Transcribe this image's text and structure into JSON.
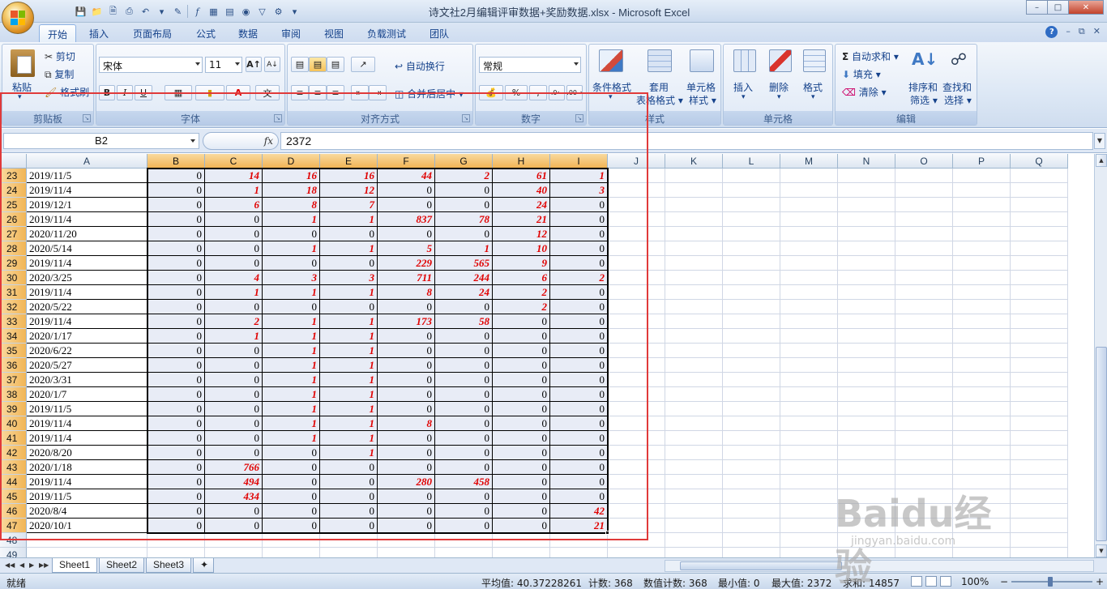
{
  "window": {
    "title": "诗文社2月编辑评审数据+奖励数据.xlsx - Microsoft Excel"
  },
  "ribbon_tabs": [
    "开始",
    "插入",
    "页面布局",
    "公式",
    "数据",
    "审阅",
    "视图",
    "负载测试",
    "团队"
  ],
  "clipboard": {
    "paste": "粘贴",
    "cut": "剪切",
    "copy": "复制",
    "format_painter": "格式刷",
    "label": "剪贴板"
  },
  "font": {
    "name": "宋体",
    "size": "11",
    "bold": "B",
    "italic": "I",
    "underline": "U",
    "label": "字体"
  },
  "alignment": {
    "wrap_text": "自动换行",
    "merge_center": "合并后居中",
    "label": "对齐方式"
  },
  "number": {
    "format": "常规",
    "percent": "%",
    "label": "数字"
  },
  "styles": {
    "conditional": "条件格式",
    "table_format_1": "套用",
    "table_format_2": "表格格式",
    "cell_styles_1": "单元格",
    "cell_styles_2": "样式",
    "label": "样式"
  },
  "cells": {
    "insert": "插入",
    "delete": "删除",
    "format": "格式",
    "label": "单元格"
  },
  "editing": {
    "autosum": "自动求和",
    "fill": "填充",
    "clear": "清除",
    "sort_1": "排序和",
    "sort_2": "筛选",
    "find_1": "查找和",
    "find_2": "选择",
    "label": "编辑"
  },
  "formula_bar": {
    "name_box": "B2",
    "fx": "fx",
    "value": "2372"
  },
  "columns": [
    "A",
    "B",
    "C",
    "D",
    "E",
    "F",
    "G",
    "H",
    "I",
    "J",
    "K",
    "L",
    "M",
    "N",
    "O",
    "P",
    "Q"
  ],
  "rows": [
    {
      "n": "23",
      "a": "2019/11/5",
      "v": [
        0,
        14,
        16,
        16,
        44,
        2,
        61,
        1
      ]
    },
    {
      "n": "24",
      "a": "2019/11/4",
      "v": [
        0,
        1,
        18,
        12,
        0,
        0,
        40,
        3
      ]
    },
    {
      "n": "25",
      "a": "2019/12/1",
      "v": [
        0,
        6,
        8,
        7,
        0,
        0,
        24,
        0
      ]
    },
    {
      "n": "26",
      "a": "2019/11/4",
      "v": [
        0,
        0,
        1,
        1,
        837,
        78,
        21,
        0
      ]
    },
    {
      "n": "27",
      "a": "2020/11/20",
      "v": [
        0,
        0,
        0,
        0,
        0,
        0,
        12,
        0
      ]
    },
    {
      "n": "28",
      "a": "2020/5/14",
      "v": [
        0,
        0,
        1,
        1,
        5,
        1,
        10,
        0
      ]
    },
    {
      "n": "29",
      "a": "2019/11/4",
      "v": [
        0,
        0,
        0,
        0,
        229,
        565,
        9,
        0
      ]
    },
    {
      "n": "30",
      "a": "2020/3/25",
      "v": [
        0,
        4,
        3,
        3,
        711,
        244,
        6,
        2
      ]
    },
    {
      "n": "31",
      "a": "2019/11/4",
      "v": [
        0,
        1,
        1,
        1,
        8,
        24,
        2,
        0
      ]
    },
    {
      "n": "32",
      "a": "2020/5/22",
      "v": [
        0,
        0,
        0,
        0,
        0,
        0,
        2,
        0
      ]
    },
    {
      "n": "33",
      "a": "2019/11/4",
      "v": [
        0,
        2,
        1,
        1,
        173,
        58,
        0,
        0
      ]
    },
    {
      "n": "34",
      "a": "2020/1/17",
      "v": [
        0,
        1,
        1,
        1,
        0,
        0,
        0,
        0
      ]
    },
    {
      "n": "35",
      "a": "2020/6/22",
      "v": [
        0,
        0,
        1,
        1,
        0,
        0,
        0,
        0
      ]
    },
    {
      "n": "36",
      "a": "2020/5/27",
      "v": [
        0,
        0,
        1,
        1,
        0,
        0,
        0,
        0
      ]
    },
    {
      "n": "37",
      "a": "2020/3/31",
      "v": [
        0,
        0,
        1,
        1,
        0,
        0,
        0,
        0
      ]
    },
    {
      "n": "38",
      "a": "2020/1/7",
      "v": [
        0,
        0,
        1,
        1,
        0,
        0,
        0,
        0
      ]
    },
    {
      "n": "39",
      "a": "2019/11/5",
      "v": [
        0,
        0,
        1,
        1,
        0,
        0,
        0,
        0
      ]
    },
    {
      "n": "40",
      "a": "2019/11/4",
      "v": [
        0,
        0,
        1,
        1,
        8,
        0,
        0,
        0
      ]
    },
    {
      "n": "41",
      "a": "2019/11/4",
      "v": [
        0,
        0,
        1,
        1,
        0,
        0,
        0,
        0
      ]
    },
    {
      "n": "42",
      "a": "2020/8/20",
      "v": [
        0,
        0,
        0,
        1,
        0,
        0,
        0,
        0
      ]
    },
    {
      "n": "43",
      "a": "2020/1/18",
      "v": [
        0,
        766,
        0,
        0,
        0,
        0,
        0,
        0
      ]
    },
    {
      "n": "44",
      "a": "2019/11/4",
      "v": [
        0,
        494,
        0,
        0,
        280,
        458,
        0,
        0
      ]
    },
    {
      "n": "45",
      "a": "2019/11/5",
      "v": [
        0,
        434,
        0,
        0,
        0,
        0,
        0,
        0
      ]
    },
    {
      "n": "46",
      "a": "2020/8/4",
      "v": [
        0,
        0,
        0,
        0,
        0,
        0,
        0,
        42
      ]
    },
    {
      "n": "47",
      "a": "2020/10/1",
      "v": [
        0,
        0,
        0,
        0,
        0,
        0,
        0,
        21
      ]
    },
    {
      "n": "48",
      "a": "",
      "v": []
    },
    {
      "n": "49",
      "a": "",
      "v": []
    }
  ],
  "sheets": [
    "Sheet1",
    "Sheet2",
    "Sheet3"
  ],
  "status": {
    "ready": "就绪",
    "average": "平均值: 40.37228261",
    "count": "计数: 368",
    "numeric_count": "数值计数: 368",
    "min": "最小值: 0",
    "max": "最大值: 2372",
    "sum": "求和: 14857",
    "zoom": "100%",
    "zoom_minus": "−",
    "zoom_plus": "+"
  },
  "watermark": {
    "brand": "Baidu经验",
    "url": "jingyan.baidu.com"
  },
  "colors": {
    "accent": "#e00000",
    "selection_header": "#f1b556",
    "range_fill": "#e8ecf6",
    "annotation_box": "#e03a3a"
  }
}
